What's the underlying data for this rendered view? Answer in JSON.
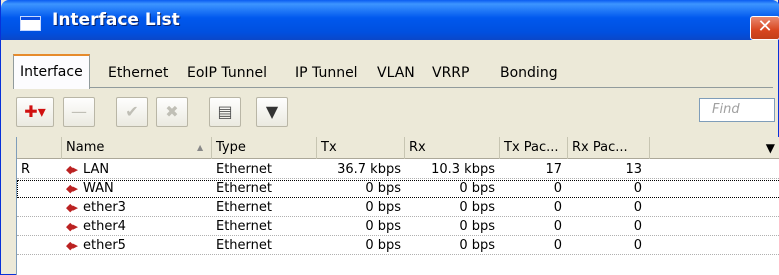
{
  "window": {
    "title": "Interface List",
    "close_glyph": "✕"
  },
  "tabs": [
    "Interface",
    "Ethernet",
    "EoIP Tunnel",
    "IP Tunnel",
    "VLAN",
    "VRRP",
    "Bonding"
  ],
  "toolbar": {
    "add": "✚▾",
    "remove": "—",
    "enable": "✔",
    "disable": "✖",
    "comment": "▤",
    "filter": "▼",
    "find_placeholder": "Find"
  },
  "table": {
    "headers": [
      "",
      "Name",
      "Type",
      "Tx",
      "Rx",
      "Tx Pac...",
      "Rx Pac..."
    ],
    "sort_glyph": "▲",
    "menu_glyph": "▼",
    "icon_glyph": "◆▸",
    "rows": [
      {
        "flag": "R",
        "name": "LAN",
        "type": "Ethernet",
        "tx": "36.7 kbps",
        "rx": "10.3 kbps",
        "txp": "17",
        "rxp": "13"
      },
      {
        "flag": "",
        "name": "WAN",
        "type": "Ethernet",
        "tx": "0 bps",
        "rx": "0 bps",
        "txp": "0",
        "rxp": "0"
      },
      {
        "flag": "",
        "name": "ether3",
        "type": "Ethernet",
        "tx": "0 bps",
        "rx": "0 bps",
        "txp": "0",
        "rxp": "0"
      },
      {
        "flag": "",
        "name": "ether4",
        "type": "Ethernet",
        "tx": "0 bps",
        "rx": "0 bps",
        "txp": "0",
        "rxp": "0"
      },
      {
        "flag": "",
        "name": "ether5",
        "type": "Ethernet",
        "tx": "0 bps",
        "rx": "0 bps",
        "txp": "0",
        "rxp": "0"
      }
    ]
  },
  "colors": {
    "title_bar": "#0058ee",
    "accent": "#e68b2c",
    "icon_red": "#b22222"
  }
}
